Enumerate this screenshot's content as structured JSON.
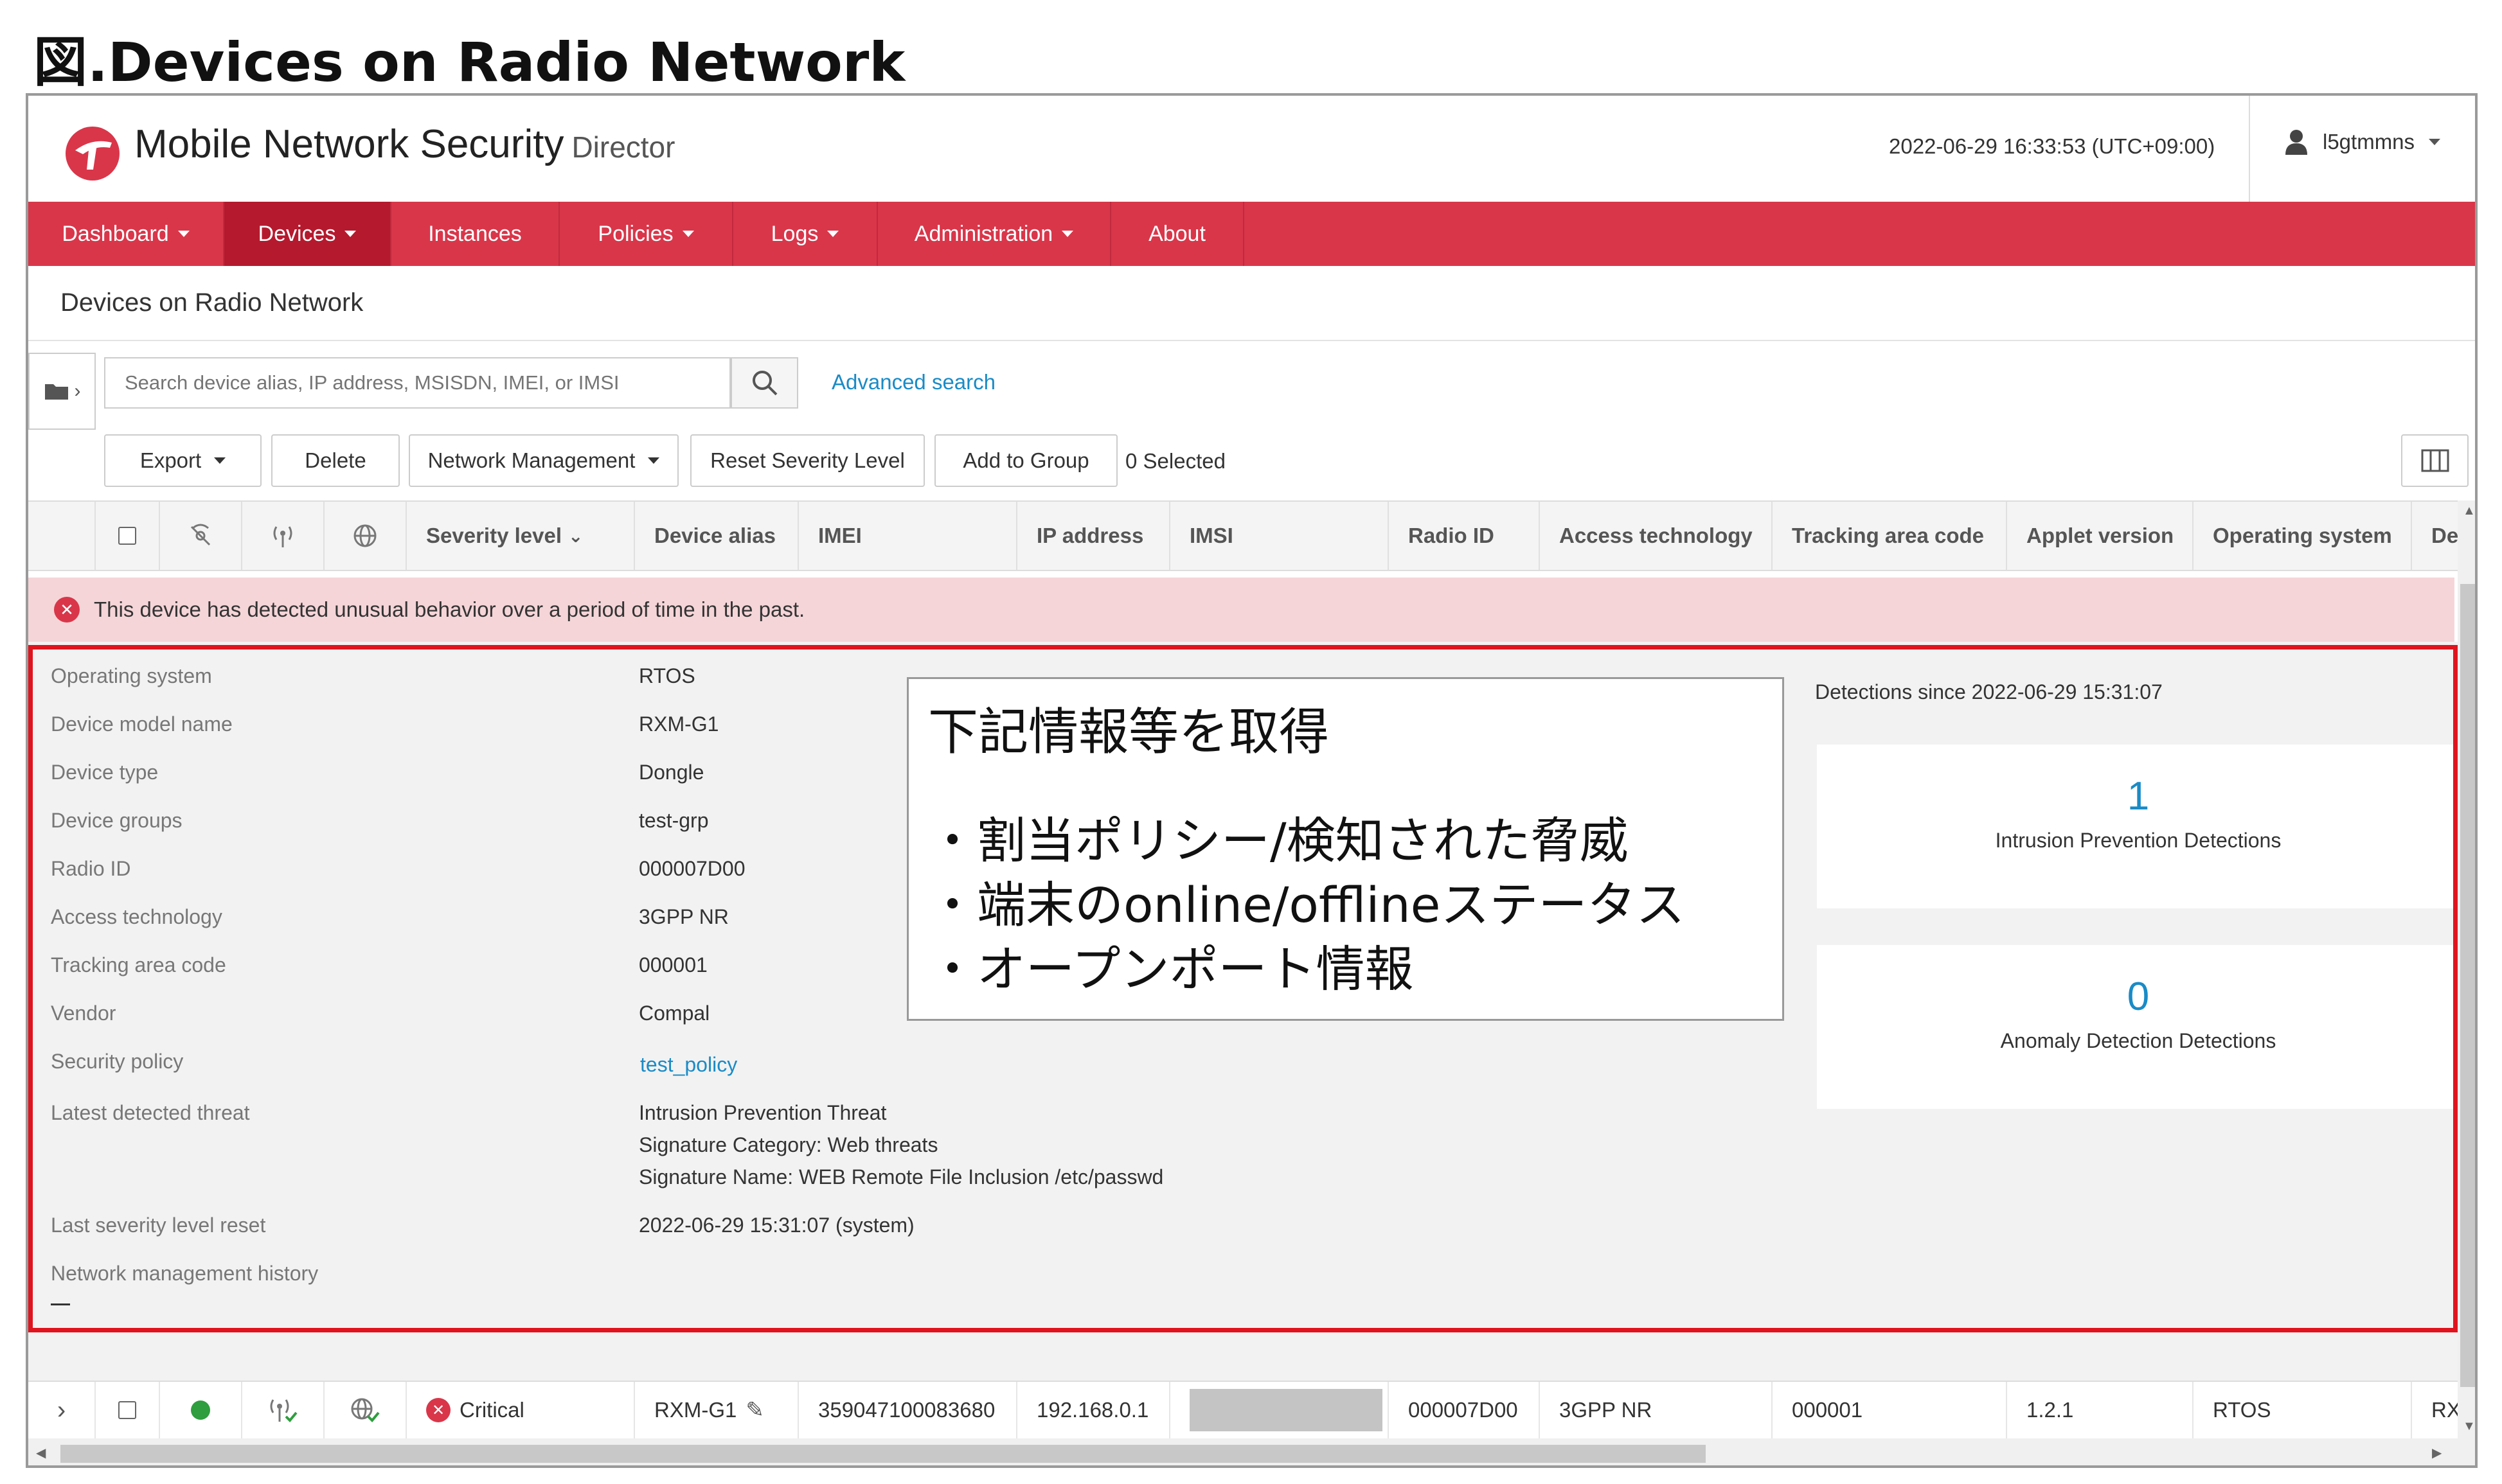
{
  "slide_title": "図.Devices on Radio Network",
  "app": {
    "brand": "Mobile Network Security",
    "brand_sub": "Director",
    "datetime": "2022-06-29 16:33:53 (UTC+09:00)",
    "user": "l5gtmmns",
    "logo_color": "#d9364a"
  },
  "nav": [
    {
      "label": "Dashboard",
      "dropdown": true
    },
    {
      "label": "Devices",
      "dropdown": true,
      "active": true
    },
    {
      "label": "Instances",
      "dropdown": false
    },
    {
      "label": "Policies",
      "dropdown": true
    },
    {
      "label": "Logs",
      "dropdown": true
    },
    {
      "label": "Administration",
      "dropdown": true
    },
    {
      "label": "About",
      "dropdown": false
    }
  ],
  "page_title": "Devices on Radio Network",
  "search": {
    "placeholder": "Search device alias, IP address, MSISDN, IMEI, or IMSI",
    "advanced_label": "Advanced search"
  },
  "toolbar": {
    "export": "Export",
    "delete": "Delete",
    "network_management": "Network Management",
    "reset_severity": "Reset Severity Level",
    "add_to_group": "Add to Group",
    "selected": "0 Selected"
  },
  "columns": {
    "severity": "Severity level",
    "alias": "Device alias",
    "imei": "IMEI",
    "ip": "IP address",
    "imsi": "IMSI",
    "radio_id": "Radio ID",
    "access_tech": "Access technology",
    "tac": "Tracking area code",
    "applet": "Applet version",
    "os": "Operating system",
    "device": "Devic"
  },
  "alert": "This device has detected unusual behavior over a period of time in the past.",
  "details": {
    "labels": {
      "os": "Operating system",
      "model": "Device model name",
      "type": "Device type",
      "groups": "Device groups",
      "radio_id": "Radio ID",
      "access_tech": "Access technology",
      "tac": "Tracking area code",
      "vendor": "Vendor",
      "policy": "Security policy",
      "threat": "Latest detected threat",
      "reset": "Last severity level reset",
      "history": "Network management history"
    },
    "values": {
      "os": "RTOS",
      "model": "RXM-G1",
      "type": "Dongle",
      "groups": "test-grp",
      "radio_id": "000007D00",
      "access_tech": "3GPP NR",
      "tac": "000001",
      "vendor": "Compal",
      "policy": "test_policy",
      "threat_1": "Intrusion Prevention Threat",
      "threat_2": "Signature Category: Web threats",
      "threat_3": "Signature Name: WEB Remote File Inclusion /etc/passwd",
      "reset": "2022-06-29 15:31:07 (system)"
    }
  },
  "callout": {
    "title": "下記情報等を取得",
    "items": [
      "・割当ポリシー/検知された脅威",
      "・端末のonline/offlineステータス",
      "・オープンポート情報"
    ]
  },
  "detections": {
    "since": "Detections since 2022-06-29 15:31:07",
    "ips_count": "1",
    "ips_label": "Intrusion Prevention Detections",
    "anomaly_count": "0",
    "anomaly_label": "Anomaly Detection Detections"
  },
  "row": {
    "severity": "Critical",
    "alias": "RXM-G1",
    "imei": "359047100083680",
    "ip": "192.168.0.1",
    "radio_id": "000007D00",
    "access_tech": "3GPP NR",
    "tac": "000001",
    "applet": "1.2.1",
    "os": "RTOS",
    "device": "RXM-"
  }
}
